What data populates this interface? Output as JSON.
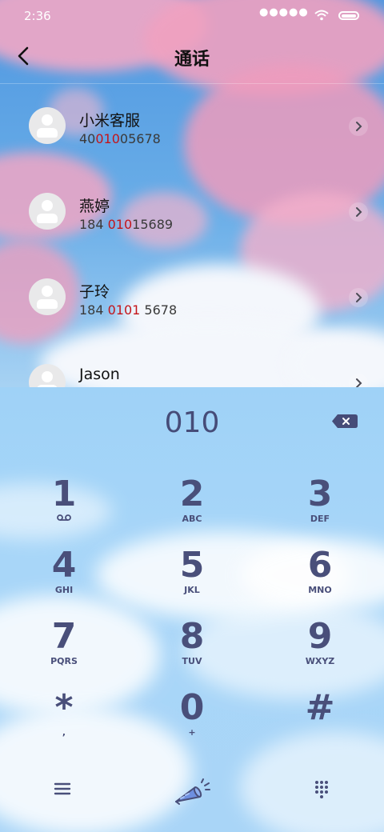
{
  "status_bar": {
    "time": "2:36",
    "signal": "●●●●●",
    "icons": [
      "wifi-icon",
      "battery-icon"
    ]
  },
  "header": {
    "title": "通话",
    "back_icon": "chevron-left-icon"
  },
  "contacts": [
    {
      "name": "小米客服",
      "number_pre": "40",
      "number_match": "010",
      "number_post": "05678"
    },
    {
      "name": "燕婷",
      "number_pre": "184 ",
      "number_match": "010",
      "number_post": "15689"
    },
    {
      "name": "子玲",
      "number_pre": "184 ",
      "number_match": "0101",
      "number_post": " 5678"
    },
    {
      "name": "Jason",
      "number_pre": "",
      "number_match": "",
      "number_post": ""
    }
  ],
  "dialer": {
    "input": "010",
    "keys": [
      {
        "digit": "1",
        "letters": ""
      },
      {
        "digit": "2",
        "letters": "ABC"
      },
      {
        "digit": "3",
        "letters": "DEF"
      },
      {
        "digit": "4",
        "letters": "GHI"
      },
      {
        "digit": "5",
        "letters": "JKL"
      },
      {
        "digit": "6",
        "letters": "MNO"
      },
      {
        "digit": "7",
        "letters": "PQRS"
      },
      {
        "digit": "8",
        "letters": "TUV"
      },
      {
        "digit": "9",
        "letters": "WXYZ"
      },
      {
        "digit": "*",
        "letters": ","
      },
      {
        "digit": "0",
        "letters": "+"
      },
      {
        "digit": "#",
        "letters": ""
      }
    ],
    "bottom_icons": [
      "menu-icon",
      "call-megaphone-icon",
      "keypad-icon"
    ]
  },
  "colors": {
    "key_text": "#494f7a",
    "match_highlight": "#c3151a",
    "sky_blue": "#a8d6f8"
  }
}
